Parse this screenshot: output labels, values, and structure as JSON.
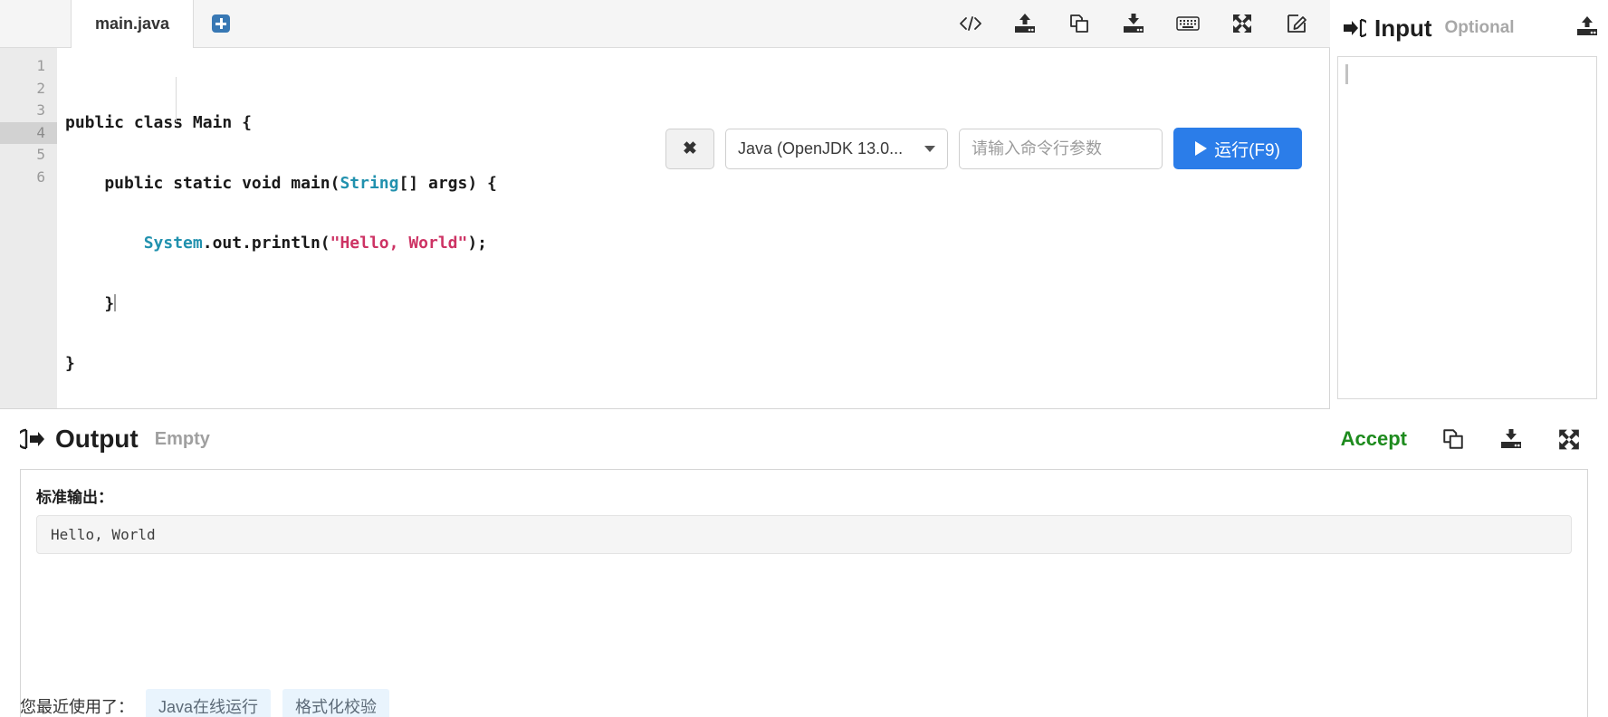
{
  "editor": {
    "tab_label": "main.java",
    "add_tab_icon": "plus-icon",
    "toolbar_icons": [
      {
        "name": "code-brackets-icon",
        "title": "</>"
      },
      {
        "name": "upload-icon",
        "title": "upload"
      },
      {
        "name": "copy-icon",
        "title": "copy"
      },
      {
        "name": "download-icon",
        "title": "download"
      },
      {
        "name": "keyboard-icon",
        "title": "keyboard"
      },
      {
        "name": "fullscreen-icon",
        "title": "fullscreen"
      },
      {
        "name": "edit-icon",
        "title": "edit"
      }
    ],
    "line_numbers": [
      "1",
      "2",
      "3",
      "4",
      "5",
      "6"
    ],
    "active_line": 4,
    "code_lines": [
      "public class Main {",
      "    public static void main(String[] args) {",
      "        System.out.println(\"Hello, World\");",
      "    }",
      "}",
      ""
    ],
    "syntax_colors": {
      "type": "#2191ae",
      "string": "#cd3364",
      "plain": "#1a1a1a"
    }
  },
  "runbar": {
    "close_label": "✖",
    "language": "Java (OpenJDK 13.0...",
    "args_placeholder": "请输入命令行参数",
    "args_value": "",
    "run_label": "运行(F9)",
    "run_color": "#2b7de9"
  },
  "input_panel": {
    "title": "Input",
    "optional_label": "Optional",
    "upload_icon": "upload-icon",
    "value": ""
  },
  "output_panel": {
    "title": "Output",
    "status_label": "Empty",
    "accept_label": "Accept",
    "accept_color": "#1e8b1e",
    "actions": [
      {
        "name": "copy-icon"
      },
      {
        "name": "download-icon"
      },
      {
        "name": "fullscreen-icon"
      }
    ],
    "stdout_label": "标准输出：",
    "stdout_content": "Hello, World"
  },
  "bottom": {
    "recent_label": "您最近使用了：",
    "tags": [
      "Java在线运行",
      "格式化校验"
    ]
  }
}
